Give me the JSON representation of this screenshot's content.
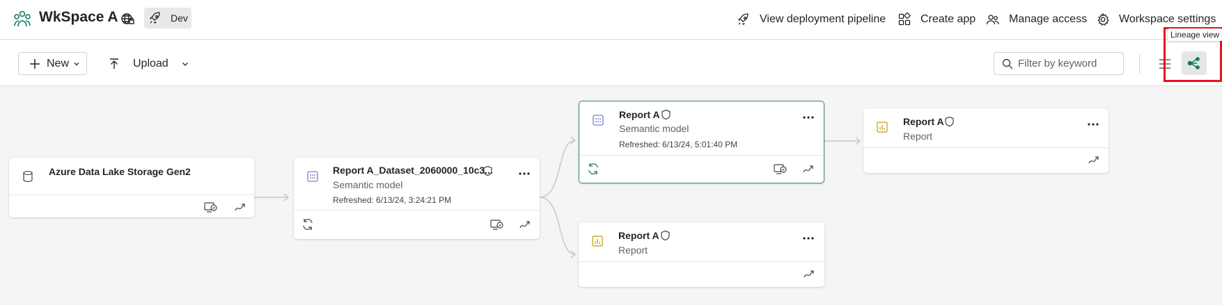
{
  "header": {
    "workspace_name": "WkSpace A",
    "badge_label": "Dev",
    "actions": [
      {
        "label": "View deployment pipeline",
        "icon": "rocket-icon"
      },
      {
        "label": "Create app",
        "icon": "app-grid-icon"
      },
      {
        "label": "Manage access",
        "icon": "people-icon"
      },
      {
        "label": "Workspace settings",
        "icon": "gear-icon"
      }
    ]
  },
  "toolbar": {
    "new_label": "New",
    "upload_label": "Upload",
    "filter_placeholder": "Filter by keyword",
    "tooltip": "Lineage view"
  },
  "colors": {
    "accent": "#117865",
    "selected_border": "#3c8e74",
    "highlight": "#e81123",
    "report_icon": "#c19c00"
  },
  "nodes": [
    {
      "name": "Azure Data Lake Storage Gen2",
      "type_icon": "database-icon",
      "subtitle": "",
      "refreshed": ""
    },
    {
      "name": "Report A_Dataset_2060000_10c3...",
      "type_icon": "semantic-model-icon",
      "subtitle": "Semantic model",
      "refreshed": "Refreshed: 6/13/24, 3:24:21 PM"
    },
    {
      "name": "Report A",
      "type_icon": "semantic-model-icon",
      "subtitle": "Semantic model",
      "refreshed": "Refreshed: 6/13/24, 5:01:40 PM"
    },
    {
      "name": "Report A",
      "type_icon": "report-icon",
      "subtitle": "Report",
      "refreshed": ""
    },
    {
      "name": "Report A",
      "type_icon": "report-icon",
      "subtitle": "Report",
      "refreshed": ""
    }
  ]
}
